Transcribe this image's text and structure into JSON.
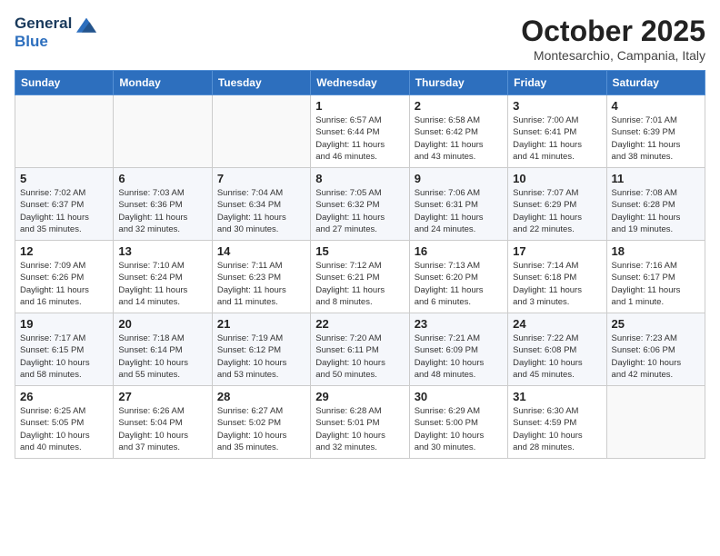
{
  "logo": {
    "line1": "General",
    "line2": "Blue"
  },
  "title": "October 2025",
  "subtitle": "Montesarchio, Campania, Italy",
  "days_of_week": [
    "Sunday",
    "Monday",
    "Tuesday",
    "Wednesday",
    "Thursday",
    "Friday",
    "Saturday"
  ],
  "weeks": [
    [
      {
        "day": "",
        "info": ""
      },
      {
        "day": "",
        "info": ""
      },
      {
        "day": "",
        "info": ""
      },
      {
        "day": "1",
        "info": "Sunrise: 6:57 AM\nSunset: 6:44 PM\nDaylight: 11 hours\nand 46 minutes."
      },
      {
        "day": "2",
        "info": "Sunrise: 6:58 AM\nSunset: 6:42 PM\nDaylight: 11 hours\nand 43 minutes."
      },
      {
        "day": "3",
        "info": "Sunrise: 7:00 AM\nSunset: 6:41 PM\nDaylight: 11 hours\nand 41 minutes."
      },
      {
        "day": "4",
        "info": "Sunrise: 7:01 AM\nSunset: 6:39 PM\nDaylight: 11 hours\nand 38 minutes."
      }
    ],
    [
      {
        "day": "5",
        "info": "Sunrise: 7:02 AM\nSunset: 6:37 PM\nDaylight: 11 hours\nand 35 minutes."
      },
      {
        "day": "6",
        "info": "Sunrise: 7:03 AM\nSunset: 6:36 PM\nDaylight: 11 hours\nand 32 minutes."
      },
      {
        "day": "7",
        "info": "Sunrise: 7:04 AM\nSunset: 6:34 PM\nDaylight: 11 hours\nand 30 minutes."
      },
      {
        "day": "8",
        "info": "Sunrise: 7:05 AM\nSunset: 6:32 PM\nDaylight: 11 hours\nand 27 minutes."
      },
      {
        "day": "9",
        "info": "Sunrise: 7:06 AM\nSunset: 6:31 PM\nDaylight: 11 hours\nand 24 minutes."
      },
      {
        "day": "10",
        "info": "Sunrise: 7:07 AM\nSunset: 6:29 PM\nDaylight: 11 hours\nand 22 minutes."
      },
      {
        "day": "11",
        "info": "Sunrise: 7:08 AM\nSunset: 6:28 PM\nDaylight: 11 hours\nand 19 minutes."
      }
    ],
    [
      {
        "day": "12",
        "info": "Sunrise: 7:09 AM\nSunset: 6:26 PM\nDaylight: 11 hours\nand 16 minutes."
      },
      {
        "day": "13",
        "info": "Sunrise: 7:10 AM\nSunset: 6:24 PM\nDaylight: 11 hours\nand 14 minutes."
      },
      {
        "day": "14",
        "info": "Sunrise: 7:11 AM\nSunset: 6:23 PM\nDaylight: 11 hours\nand 11 minutes."
      },
      {
        "day": "15",
        "info": "Sunrise: 7:12 AM\nSunset: 6:21 PM\nDaylight: 11 hours\nand 8 minutes."
      },
      {
        "day": "16",
        "info": "Sunrise: 7:13 AM\nSunset: 6:20 PM\nDaylight: 11 hours\nand 6 minutes."
      },
      {
        "day": "17",
        "info": "Sunrise: 7:14 AM\nSunset: 6:18 PM\nDaylight: 11 hours\nand 3 minutes."
      },
      {
        "day": "18",
        "info": "Sunrise: 7:16 AM\nSunset: 6:17 PM\nDaylight: 11 hours\nand 1 minute."
      }
    ],
    [
      {
        "day": "19",
        "info": "Sunrise: 7:17 AM\nSunset: 6:15 PM\nDaylight: 10 hours\nand 58 minutes."
      },
      {
        "day": "20",
        "info": "Sunrise: 7:18 AM\nSunset: 6:14 PM\nDaylight: 10 hours\nand 55 minutes."
      },
      {
        "day": "21",
        "info": "Sunrise: 7:19 AM\nSunset: 6:12 PM\nDaylight: 10 hours\nand 53 minutes."
      },
      {
        "day": "22",
        "info": "Sunrise: 7:20 AM\nSunset: 6:11 PM\nDaylight: 10 hours\nand 50 minutes."
      },
      {
        "day": "23",
        "info": "Sunrise: 7:21 AM\nSunset: 6:09 PM\nDaylight: 10 hours\nand 48 minutes."
      },
      {
        "day": "24",
        "info": "Sunrise: 7:22 AM\nSunset: 6:08 PM\nDaylight: 10 hours\nand 45 minutes."
      },
      {
        "day": "25",
        "info": "Sunrise: 7:23 AM\nSunset: 6:06 PM\nDaylight: 10 hours\nand 42 minutes."
      }
    ],
    [
      {
        "day": "26",
        "info": "Sunrise: 6:25 AM\nSunset: 5:05 PM\nDaylight: 10 hours\nand 40 minutes."
      },
      {
        "day": "27",
        "info": "Sunrise: 6:26 AM\nSunset: 5:04 PM\nDaylight: 10 hours\nand 37 minutes."
      },
      {
        "day": "28",
        "info": "Sunrise: 6:27 AM\nSunset: 5:02 PM\nDaylight: 10 hours\nand 35 minutes."
      },
      {
        "day": "29",
        "info": "Sunrise: 6:28 AM\nSunset: 5:01 PM\nDaylight: 10 hours\nand 32 minutes."
      },
      {
        "day": "30",
        "info": "Sunrise: 6:29 AM\nSunset: 5:00 PM\nDaylight: 10 hours\nand 30 minutes."
      },
      {
        "day": "31",
        "info": "Sunrise: 6:30 AM\nSunset: 4:59 PM\nDaylight: 10 hours\nand 28 minutes."
      },
      {
        "day": "",
        "info": ""
      }
    ]
  ]
}
